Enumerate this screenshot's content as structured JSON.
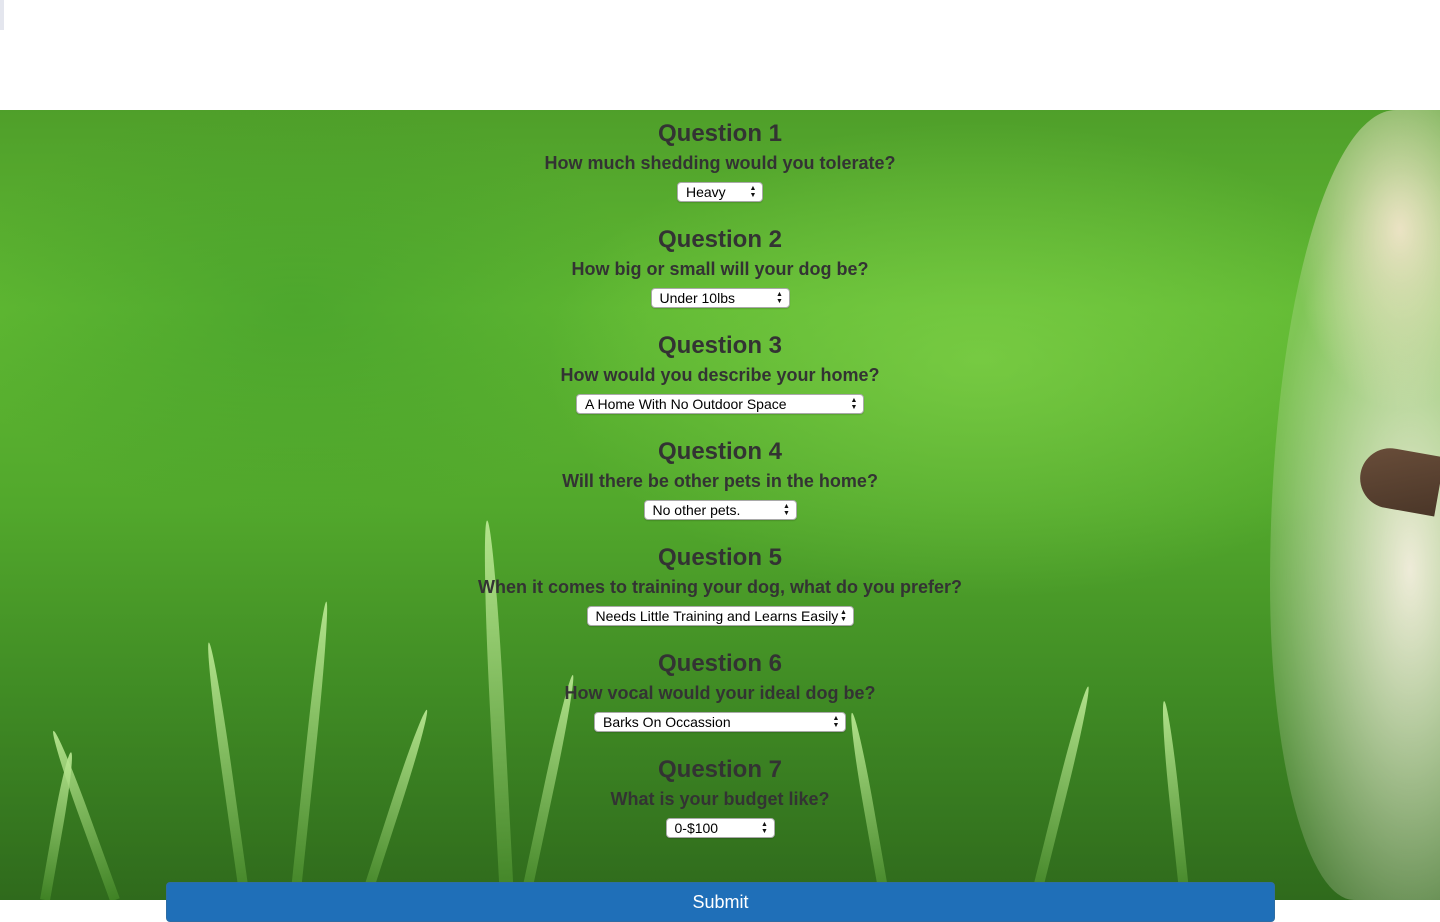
{
  "questions": [
    {
      "title": "Question 1",
      "text": "How much shedding would you tolerate?",
      "selected": "Heavy"
    },
    {
      "title": "Question 2",
      "text": "How big or small will your dog be?",
      "selected": "Under 10lbs"
    },
    {
      "title": "Question 3",
      "text": "How would you describe your home?",
      "selected": "A Home With No Outdoor Space"
    },
    {
      "title": "Question 4",
      "text": "Will there be other pets in the home?",
      "selected": "No other pets."
    },
    {
      "title": "Question 5",
      "text": "When it comes to training your dog, what do you prefer?",
      "selected": "Needs Little Training and Learns Easily"
    },
    {
      "title": "Question 6",
      "text": "How vocal would your ideal dog be?",
      "selected": "Barks On Occassion"
    },
    {
      "title": "Question 7",
      "text": "What is your budget like?",
      "selected": "0-$100"
    }
  ],
  "submit_label": "Submit",
  "colors": {
    "text": "#333333",
    "submit_background": "#1f6fb8",
    "background_grass": "#5fb832"
  },
  "icons": {
    "select_arrows": "updown-arrows-icon"
  }
}
